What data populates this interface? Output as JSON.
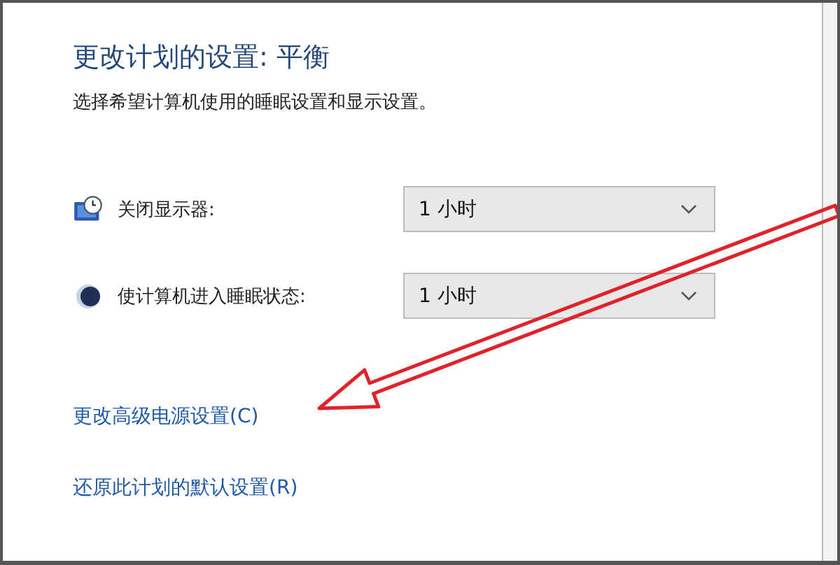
{
  "title": "更改计划的设置: 平衡",
  "description": "选择希望计算机使用的睡眠设置和显示设置。",
  "settings": [
    {
      "kind": "display",
      "label": "关闭显示器:",
      "value": "1 小时"
    },
    {
      "kind": "sleep",
      "label": "使计算机进入睡眠状态:",
      "value": "1 小时"
    }
  ],
  "links": [
    "更改高级电源设置(C)",
    "还原此计划的默认设置(R)"
  ]
}
